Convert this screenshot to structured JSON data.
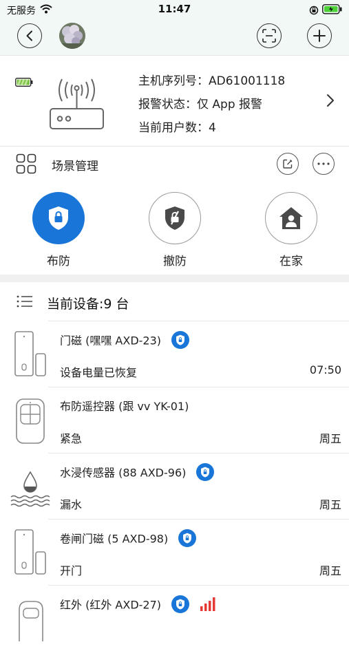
{
  "status_bar": {
    "carrier": "无服务",
    "time": "11:47"
  },
  "host": {
    "serial_label": "主机序列号：",
    "serial_value": "AD61001118",
    "alarm_label": "报警状态：",
    "alarm_value": "仅 App 报警",
    "users_label": "当前用户数：",
    "users_value": "4"
  },
  "scene": {
    "label": "场景管理"
  },
  "modes": [
    {
      "label": "布防",
      "active": true
    },
    {
      "label": "撤防",
      "active": false
    },
    {
      "label": "在家",
      "active": false
    }
  ],
  "devices_header": {
    "title": "当前设备:9 台"
  },
  "devices": [
    {
      "name": "门磁 (嘿嘿 AXD-23)",
      "status": "设备电量已恢复",
      "time": "07:50",
      "icon": "door-sensor-icon",
      "shield": true,
      "signal": false
    },
    {
      "name": "布防遥控器 (跟 vv YK-01)",
      "status": "紧急",
      "time": "周五",
      "icon": "remote-control-icon",
      "shield": false,
      "signal": false
    },
    {
      "name": "水浸传感器 (88 AXD-96)",
      "status": "漏水",
      "time": "周五",
      "icon": "water-sensor-icon",
      "shield": true,
      "signal": false
    },
    {
      "name": "卷闸门磁 (5 AXD-98)",
      "status": "开门",
      "time": "周五",
      "icon": "door-sensor-icon",
      "shield": true,
      "signal": false
    },
    {
      "name": "红外 (红外 AXD-27)",
      "status": "",
      "time": "",
      "icon": "infrared-sensor-icon",
      "shield": true,
      "signal": true
    }
  ],
  "colors": {
    "accent": "#1976d8",
    "signal": "#e53935",
    "battery": "#7cc242",
    "header_bg": "#f2f8f5"
  }
}
